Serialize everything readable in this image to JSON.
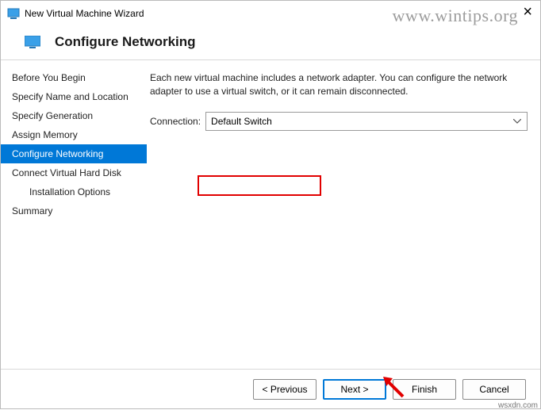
{
  "window": {
    "title": "New Virtual Machine Wizard"
  },
  "header": {
    "title": "Configure Networking"
  },
  "sidebar": {
    "items": [
      {
        "label": "Before You Begin",
        "active": false,
        "indent": false
      },
      {
        "label": "Specify Name and Location",
        "active": false,
        "indent": false
      },
      {
        "label": "Specify Generation",
        "active": false,
        "indent": false
      },
      {
        "label": "Assign Memory",
        "active": false,
        "indent": false
      },
      {
        "label": "Configure Networking",
        "active": true,
        "indent": false
      },
      {
        "label": "Connect Virtual Hard Disk",
        "active": false,
        "indent": false
      },
      {
        "label": "Installation Options",
        "active": false,
        "indent": true
      },
      {
        "label": "Summary",
        "active": false,
        "indent": false
      }
    ]
  },
  "main": {
    "description": "Each new virtual machine includes a network adapter. You can configure the network adapter to use a virtual switch, or it can remain disconnected.",
    "connection_label": "Connection:",
    "connection_value": "Default Switch"
  },
  "footer": {
    "previous": "< Previous",
    "next": "Next >",
    "finish": "Finish",
    "cancel": "Cancel"
  },
  "watermark": {
    "site": "www.wintips.org",
    "source": "wsxdn.com"
  }
}
